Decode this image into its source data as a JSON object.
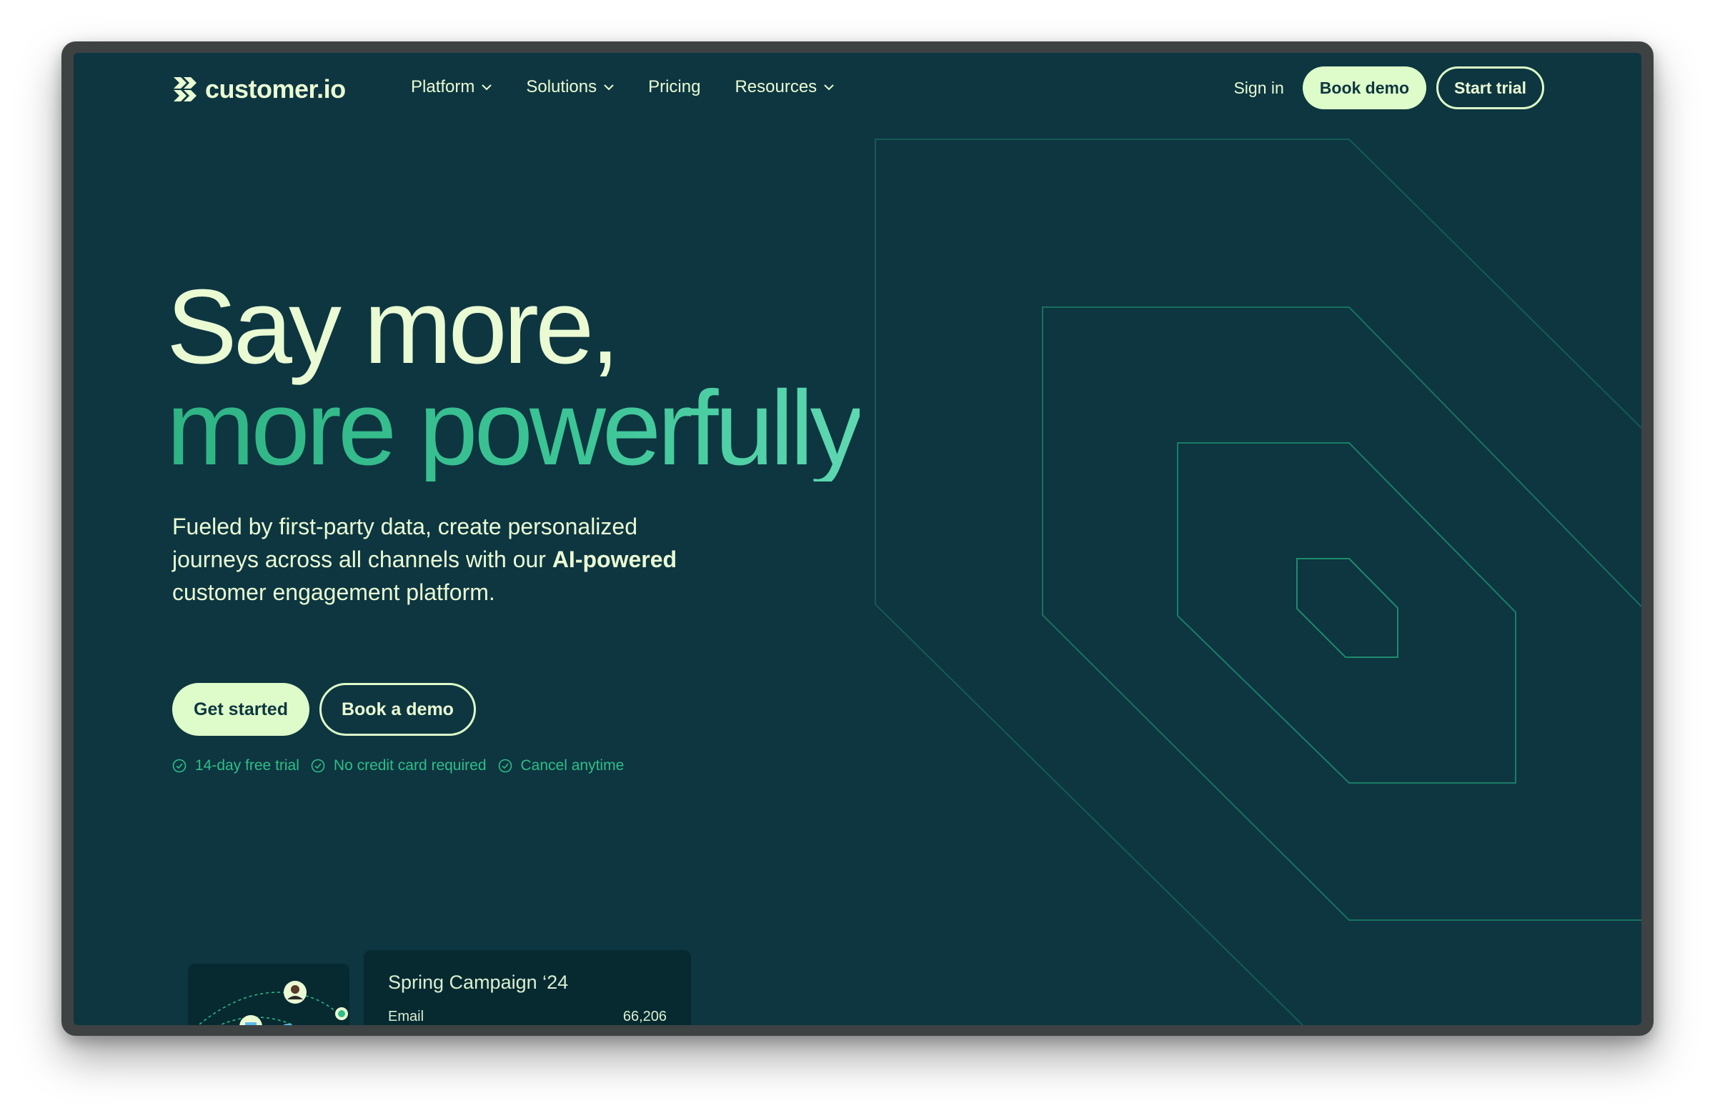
{
  "brand": {
    "name": "customer.io"
  },
  "nav": {
    "items": [
      {
        "label": "Platform",
        "has_dropdown": true
      },
      {
        "label": "Solutions",
        "has_dropdown": true
      },
      {
        "label": "Pricing",
        "has_dropdown": false
      },
      {
        "label": "Resources",
        "has_dropdown": true
      }
    ],
    "sign_in": "Sign in",
    "book_demo": "Book demo",
    "start_trial": "Start trial"
  },
  "hero": {
    "headline_line1": "Say more,",
    "headline_line2": "more powerfully",
    "sub_before": "Fueled by first-party data, create personalized journeys across all channels with our ",
    "sub_bold": "AI-powered",
    "sub_after": " customer engagement platform.",
    "cta_primary": "Get started",
    "cta_secondary": "Book a demo",
    "perks": [
      "14-day free trial",
      "No credit card required",
      "Cancel anytime"
    ]
  },
  "campaign_card": {
    "title": "Spring Campaign ‘24",
    "row_label": "Email",
    "row_value": "66,206"
  },
  "colors": {
    "background": "#0d3640",
    "accent_light": "#ddfcc9",
    "accent_green": "#2fb484",
    "outline_green": "#1f8a6e"
  },
  "icons": {
    "logo": "customerio-logo-icon",
    "chevron": "chevron-down-icon",
    "check": "check-circle-icon"
  }
}
